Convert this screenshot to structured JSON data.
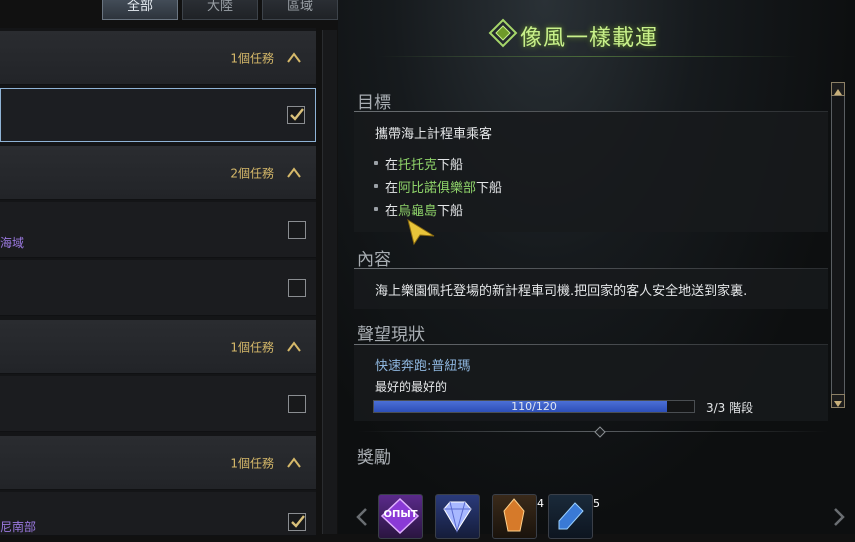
{
  "tabs": [
    {
      "label": "全部",
      "active": true
    },
    {
      "label": "大陸",
      "active": false
    },
    {
      "label": "區域",
      "active": false
    }
  ],
  "quest_list": {
    "groups": [
      {
        "count": "1個任務"
      },
      {
        "count": "2個任務"
      },
      {
        "count": "1個任務"
      },
      {
        "count": "1個任務"
      }
    ],
    "items": [
      {
        "title": "",
        "checked": true,
        "selected": true
      },
      {
        "title": "海域",
        "checked": false
      },
      {
        "title": "",
        "checked": false
      },
      {
        "title": "",
        "checked": false
      },
      {
        "title": "尼南部",
        "checked": true
      }
    ]
  },
  "detail": {
    "title": "像風一樣載運",
    "objective": {
      "label": "目標",
      "main": "攜帶海上計程車乘客",
      "steps": [
        {
          "prefix": "在",
          "place": "托托克",
          "suffix": "下船"
        },
        {
          "prefix": "在",
          "place": "阿比諾俱樂部",
          "suffix": "下船"
        },
        {
          "prefix": "在",
          "place": "烏龜島",
          "suffix": "下船"
        }
      ]
    },
    "content": {
      "label": "內容",
      "text": "海上樂園佩托登場的新計程車司機.把回家的客人安全地送到家裏."
    },
    "reputation": {
      "label": "聲望現狀",
      "name": "快速奔跑:普紐瑪",
      "rank": "最好的最好的",
      "progress_text": "110/120",
      "progress_fraction": 0.9167,
      "stage": "3/3 階段"
    },
    "rewards": {
      "label": "獎勵",
      "items": [
        {
          "icon": "exp-icon",
          "text": "OПЫТ",
          "count": ""
        },
        {
          "icon": "diamond-icon",
          "count": ""
        },
        {
          "icon": "crystal-icon",
          "count": "4"
        },
        {
          "icon": "potion-icon",
          "count": "5"
        }
      ]
    }
  },
  "colors": {
    "title_green": "#c8f08a",
    "highlight_green": "#8fd46a",
    "count_gold": "#d6b96a",
    "purple_text": "#9b79e0",
    "progress_blue": "#3d5fd0"
  }
}
